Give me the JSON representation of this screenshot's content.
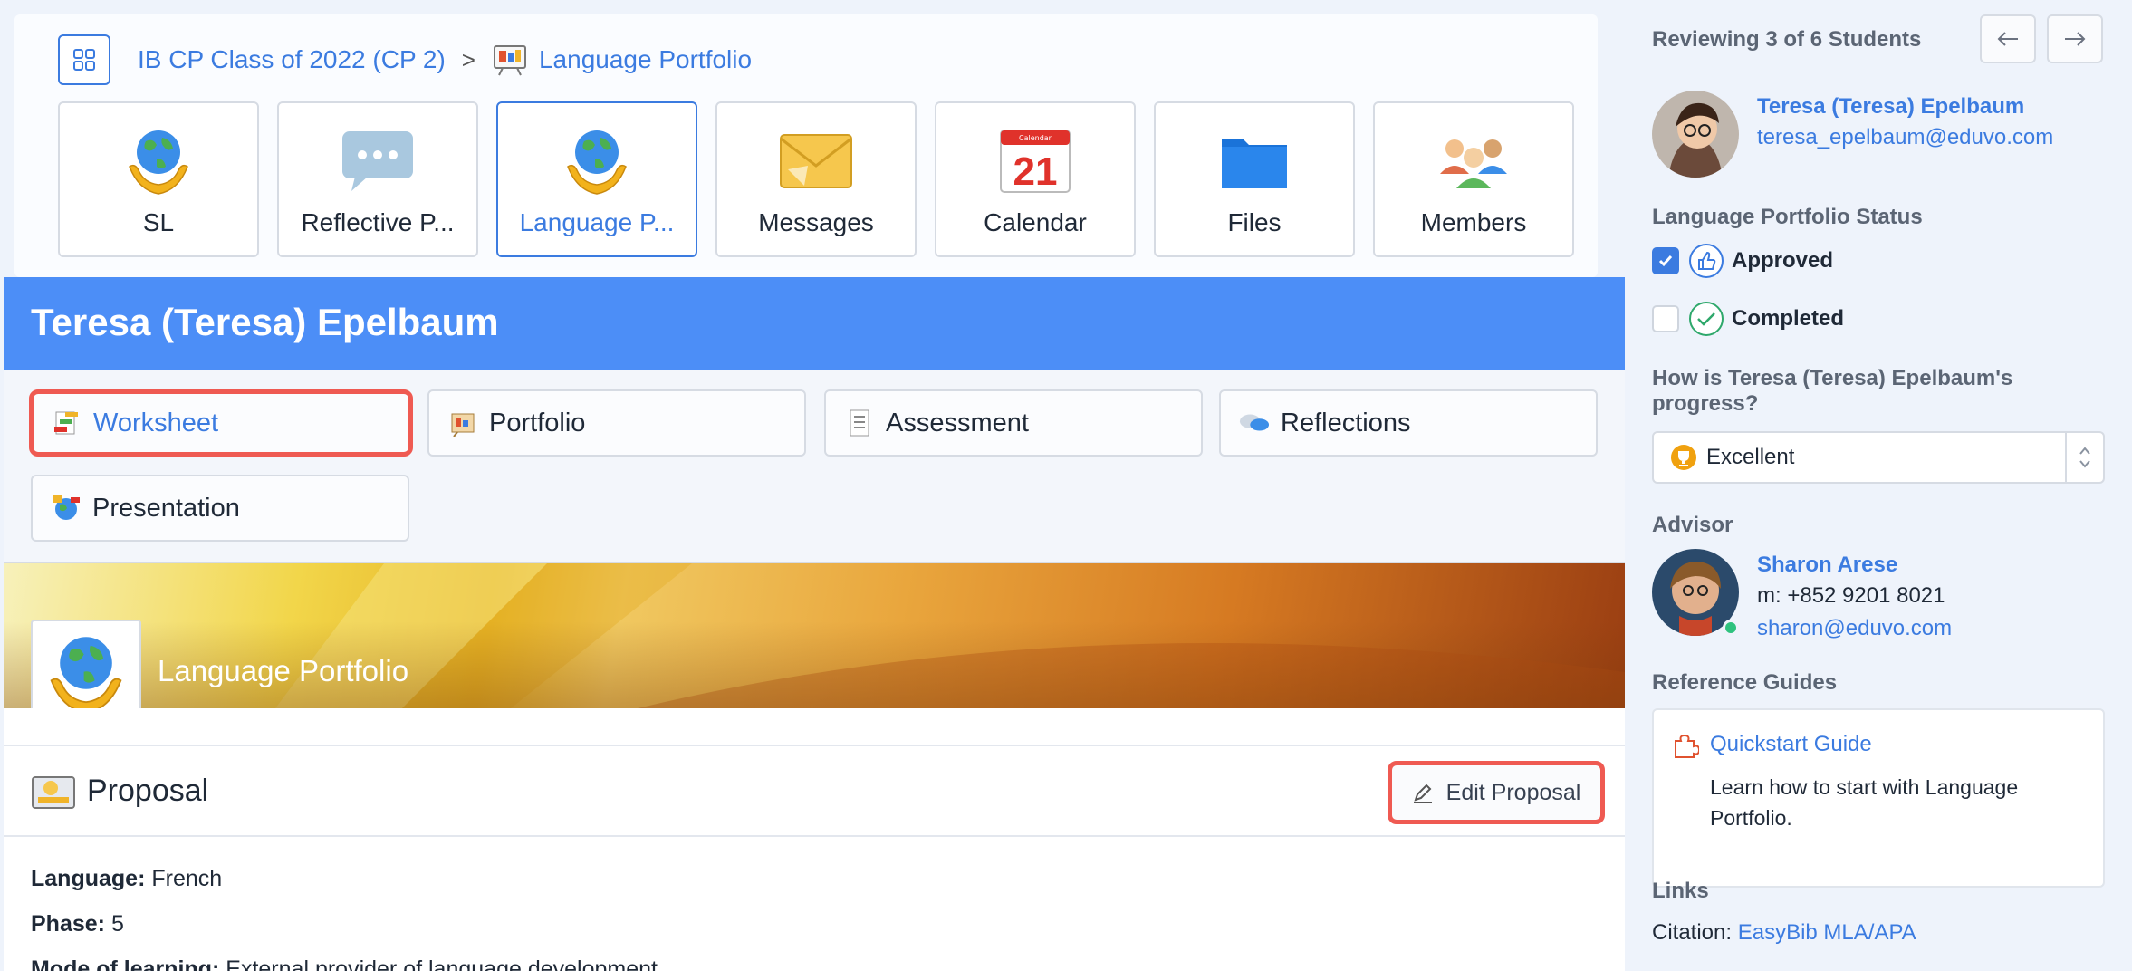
{
  "breadcrumb": {
    "class_name": "IB CP Class of 2022 (CP 2)",
    "separator": ">",
    "current": "Language Portfolio"
  },
  "apps": [
    {
      "label": "SL",
      "icon": "globe-hands-icon"
    },
    {
      "label": "Reflective P...",
      "icon": "speech-bubble-icon"
    },
    {
      "label": "Language P...",
      "icon": "globe-hands-icon",
      "active": true
    },
    {
      "label": "Messages",
      "icon": "envelope-icon"
    },
    {
      "label": "Calendar",
      "icon": "calendar-icon",
      "calendar_header": "Calendar",
      "calendar_day": "21"
    },
    {
      "label": "Files",
      "icon": "folder-icon"
    },
    {
      "label": "Members",
      "icon": "people-icon"
    }
  ],
  "student": {
    "name": "Teresa (Teresa) Epelbaum"
  },
  "tabs": [
    {
      "label": "Worksheet",
      "icon": "worksheet-icon",
      "selected": true
    },
    {
      "label": "Portfolio",
      "icon": "portfolio-icon"
    },
    {
      "label": "Assessment",
      "icon": "assessment-icon"
    },
    {
      "label": "Reflections",
      "icon": "reflections-icon"
    },
    {
      "label": "Presentation",
      "icon": "presentation-icon"
    }
  ],
  "banner": {
    "title": "Language Portfolio"
  },
  "proposal": {
    "title": "Proposal",
    "edit_label": "Edit Proposal",
    "fields": [
      {
        "label": "Language:",
        "value": "French"
      },
      {
        "label": "Phase:",
        "value": "5"
      },
      {
        "label": "Mode of learning:",
        "value": "External provider of language development"
      }
    ]
  },
  "sidebar": {
    "reviewing": "Reviewing 3 of 6 Students",
    "student_name": "Teresa (Teresa) Epelbaum",
    "student_email": "teresa_epelbaum@eduvo.com",
    "status_heading": "Language Portfolio Status",
    "statuses": [
      {
        "label": "Approved",
        "checked": true
      },
      {
        "label": "Completed",
        "checked": false
      }
    ],
    "progress_question": "How is Teresa (Teresa) Epelbaum's progress?",
    "progress_value": "Excellent",
    "advisor_heading": "Advisor",
    "advisor_name": "Sharon Arese",
    "advisor_phone": "m: +852 9201 8021",
    "advisor_email": "sharon@eduvo.com",
    "guides_heading": "Reference Guides",
    "guide_title": "Quickstart Guide",
    "guide_desc": "Learn how to start with Language Portfolio.",
    "links_heading": "Links",
    "citation_label": "Citation:",
    "citation_link": "EasyBib MLA/APA"
  },
  "colors": {
    "accent": "#3b7be0",
    "header_bar": "#4c8ef7",
    "highlight": "#ef5a52"
  }
}
